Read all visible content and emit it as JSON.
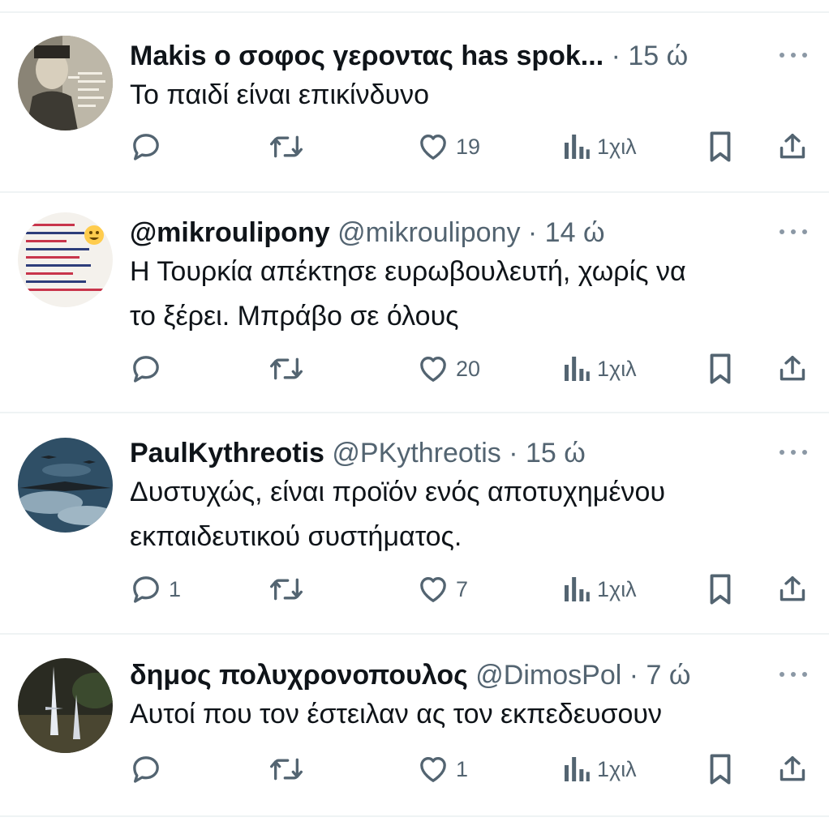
{
  "tweets": [
    {
      "name": "Makis ο σοφος γεροντας has spok...",
      "handle": "",
      "time": "· 15 ώ",
      "text_lines": [
        "Το παιδί είναι επικίνδυνο"
      ],
      "replies": "",
      "likes": "19",
      "views": "1χιλ",
      "avatar": "man-cigarette-photo"
    },
    {
      "name": "@mikroulipony",
      "handle": "@mikroulipony",
      "time": "· 14 ώ",
      "text_lines": [
        "Η Τουρκία απέκτησε ευρωβουλευτή, χωρίς να",
        "το ξέρει. Μπράβο σε όλους"
      ],
      "replies": "",
      "likes": "20",
      "views": "1χιλ",
      "avatar": "handwritten-note-photo"
    },
    {
      "name": "PaulKythreotis",
      "handle": "@PKythreotis",
      "time": "· 15 ώ",
      "text_lines": [
        "Δυστυχώς, είναι προϊόν ενός αποτυχημένου",
        "εκπαιδευτικού συστήματος."
      ],
      "replies": "1",
      "likes": "7",
      "views": "1χιλ",
      "avatar": "aircraft-sky-photo"
    },
    {
      "name": "δημος πολυχρονοπουλος",
      "handle": "@DimosPol",
      "time": "· 7 ώ",
      "text_lines": [
        "Αυτοί που τον έστειλαν ας τον εκπεδευσουν"
      ],
      "replies": "",
      "likes": "1",
      "views": "1χιλ",
      "avatar": "night-spikes-photo"
    }
  ],
  "icons": {
    "reply": "reply-icon",
    "retweet": "retweet-icon",
    "like": "heart-icon",
    "views": "views-icon",
    "bookmark": "bookmark-icon",
    "share": "share-icon",
    "more": "more-icon"
  },
  "colors": {
    "text": "#0f1419",
    "secondary": "#536471",
    "divider": "#eff3f4"
  }
}
